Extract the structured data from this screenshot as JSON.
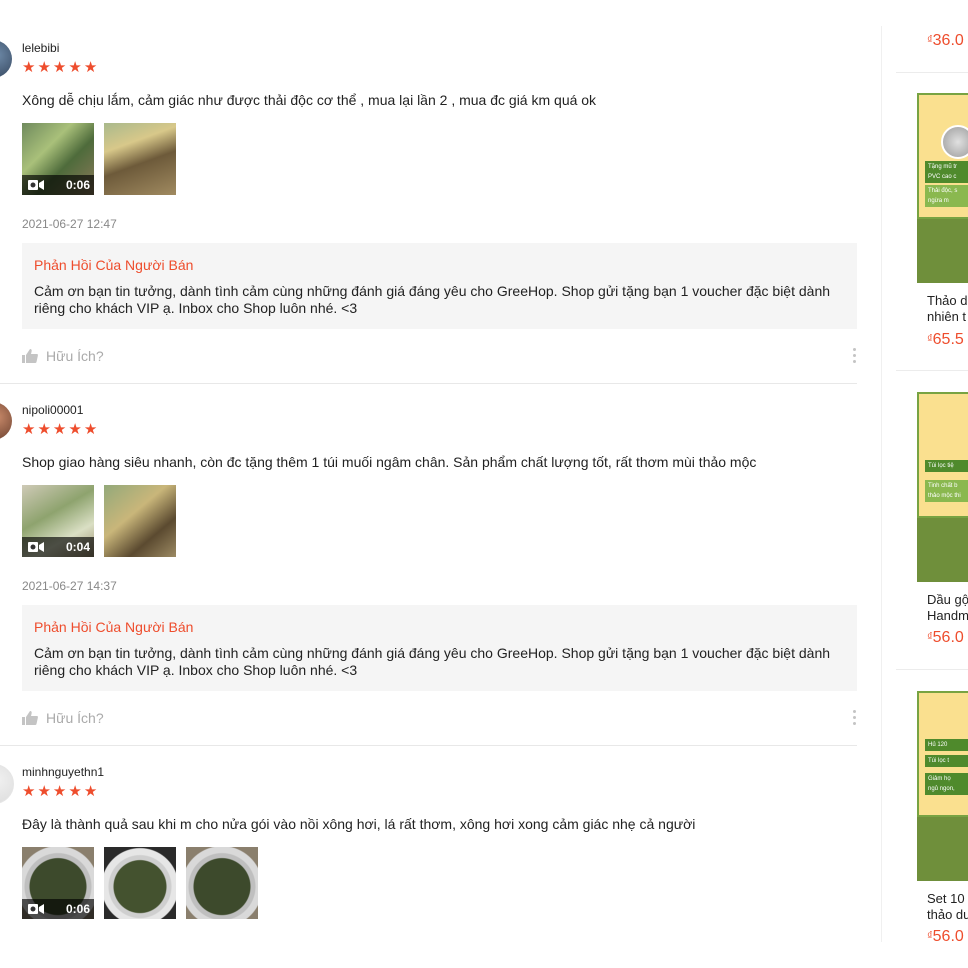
{
  "reviews": [
    {
      "username": "lelebibi",
      "rating": 5,
      "comment": "Xông dễ chịu lắm, cảm giác như được thải độc cơ thể , mua lại lần 2 , mua đc giá km quá ok",
      "media": [
        {
          "type": "video",
          "duration": "0:06"
        },
        {
          "type": "image"
        }
      ],
      "timestamp": "2021-06-27 12:47",
      "seller_reply": {
        "title": "Phản Hồi Của Người Bán",
        "text": "Cảm ơn bạn tin tưởng, dành tình cảm cùng những đánh giá đáng yêu cho GreeHop. Shop gửi tặng bạn 1 voucher đặc biệt dành riêng cho khách VIP ạ. Inbox cho Shop luôn nhé. <3"
      },
      "helpful_label": "Hữu Ích?"
    },
    {
      "username": "nipoli00001",
      "rating": 5,
      "comment": "Shop giao hàng siêu nhanh, còn đc tặng thêm 1 túi muối ngâm chân. Sản phẩm chất lượng tốt, rất thơm mùi thảo mộc",
      "media": [
        {
          "type": "video",
          "duration": "0:04"
        },
        {
          "type": "image"
        }
      ],
      "timestamp": "2021-06-27 14:37",
      "seller_reply": {
        "title": "Phản Hồi Của Người Bán",
        "text": "Cảm ơn bạn tin tưởng, dành tình cảm cùng những đánh giá đáng yêu cho GreeHop. Shop gửi tặng bạn 1 voucher đặc biệt dành riêng cho khách VIP ạ. Inbox cho Shop luôn nhé. <3"
      },
      "helpful_label": "Hữu Ích?"
    },
    {
      "username": "minhnguyethn1",
      "rating": 5,
      "comment": "Đây là thành quả sau khi m cho nửa gói vào nồi xông hơi, lá rất thơm, xông hơi xong cảm giác nhẹ cả người",
      "media": [
        {
          "type": "video",
          "duration": "0:06"
        },
        {
          "type": "image"
        },
        {
          "type": "image"
        }
      ]
    }
  ],
  "sidebar": {
    "currency": "₫",
    "top_price": "36.0",
    "products": [
      {
        "name_line1": "Thảo d",
        "name_line2": "nhiên t",
        "price": "65.5",
        "banner_text": [
          "Tặng mũ tr",
          "PVC cao c",
          "Thải độc, s",
          "ngừa m"
        ]
      },
      {
        "name_line1": "Dầu gộ",
        "name_line2": "Handm",
        "price": "56.0",
        "banner_text": [
          "Túi lọc tiệ",
          "Tinh chất b",
          "thảo mộc thi"
        ]
      },
      {
        "name_line1": "Set 10",
        "name_line2": "thảo dư",
        "price": "56.0",
        "banner_text": [
          "Hủ 120",
          "Túi lọc t",
          "Giảm họ",
          "ngủ ngon,"
        ]
      }
    ]
  },
  "colors": {
    "accent": "#ee4d2d",
    "reply_bg": "#f5f5f5",
    "muted": "#888888"
  },
  "icons": {
    "star": "star-icon",
    "video": "camera-icon",
    "helpful": "thumbs-up-icon",
    "more": "more-vertical-icon"
  }
}
